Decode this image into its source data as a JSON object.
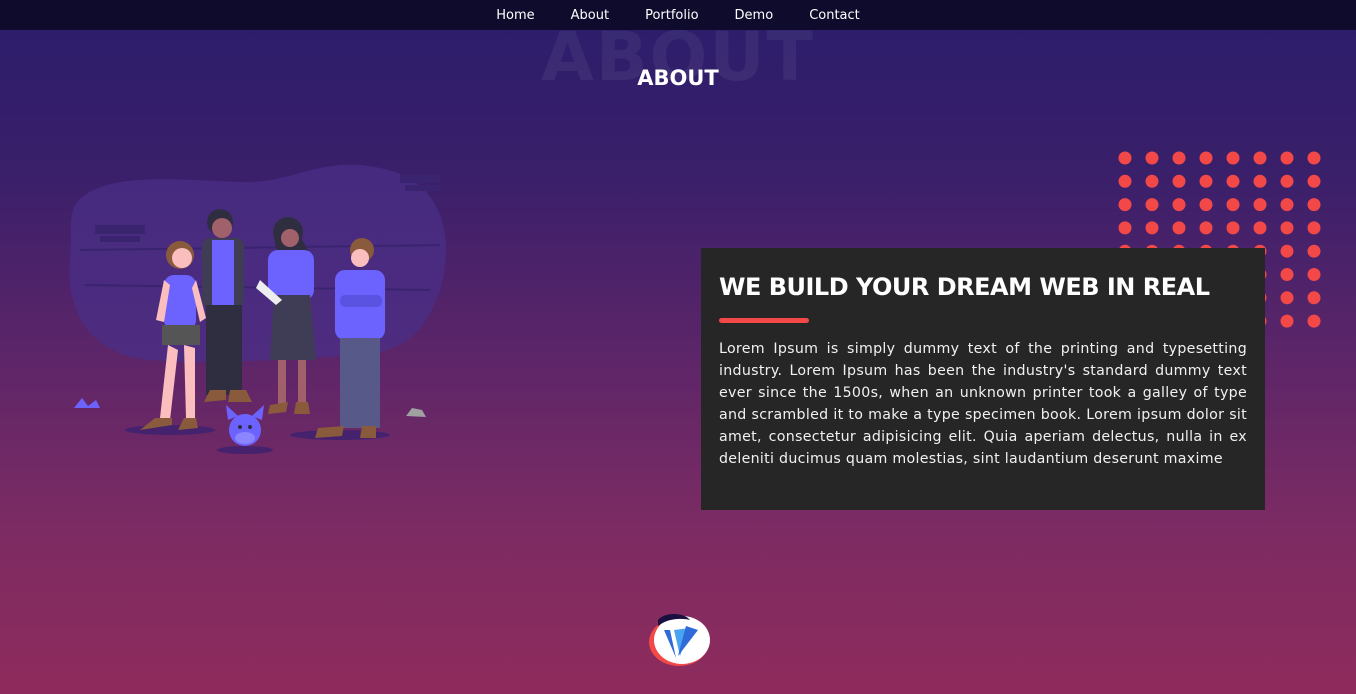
{
  "nav": {
    "items": [
      "Home",
      "About",
      "Portfolio",
      "Demo",
      "Contact"
    ]
  },
  "hero": {
    "ghost_title": "ABOUT",
    "title": "ABOUT"
  },
  "card": {
    "title": "WE BUILD YOUR DREAM WEB IN REAL",
    "text": "Lorem Ipsum is simply dummy text of the printing and typesetting industry. Lorem Ipsum has been the industry's standard dummy text ever since the 1500s, when an unknown printer took a galley of type and scrambled it to make a type specimen book. Lorem ipsum dolor sit amet, consectetur adipisicing elit. Quia aperiam delectus, nulla in ex deleniti ducimus quam molestias, sint laudantium deserunt maxime"
  },
  "icons": {
    "illustration": "team-illustration",
    "dots": "dot-pattern",
    "logo": "brand-logo"
  },
  "colors": {
    "accent": "#f24848",
    "card_bg": "#262626",
    "nav_bg": "#0f0b2d",
    "purple": "#6c63ff"
  }
}
